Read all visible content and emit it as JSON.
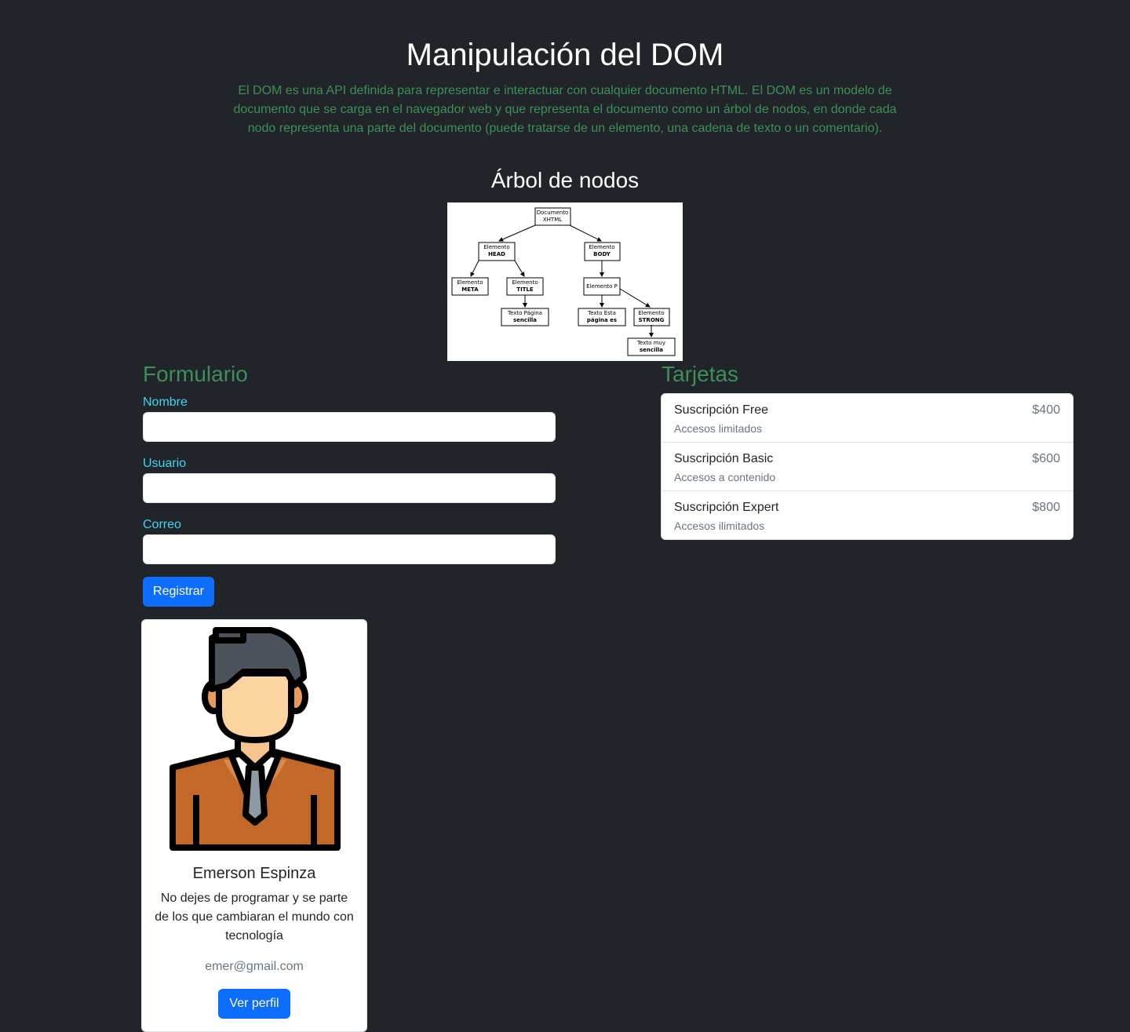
{
  "header": {
    "title": "Manipulación del DOM",
    "intro": "El DOM es una API definida para representar e interactuar con cualquier documento HTML. El DOM es un modelo de documento que se carga en el navegador web y que representa el documento como un árbol de nodos, en donde cada nodo representa una parte del documento (puede tratarse de un elemento, una cadena de texto o un comentario)."
  },
  "tree": {
    "title": "Árbol de nodos",
    "nodes": {
      "doc": [
        "Documento",
        "XHTML"
      ],
      "head": [
        "Elemento",
        "HEAD"
      ],
      "body": [
        "Elemento",
        "BODY"
      ],
      "meta": [
        "Elemento",
        "META"
      ],
      "title": [
        "Elemento",
        "TITLE"
      ],
      "p": [
        "Elemento P"
      ],
      "text_title": [
        "Texto Página",
        "sencilla"
      ],
      "text_p": [
        "Texto Esta",
        "página es"
      ],
      "strong": [
        "Elemento",
        "STRONG"
      ],
      "text_strong": [
        "Texto muy",
        "sencilla"
      ]
    }
  },
  "form": {
    "title": "Formulario",
    "fields": [
      {
        "label": "Nombre",
        "value": "",
        "placeholder": ""
      },
      {
        "label": "Usuario",
        "value": "",
        "placeholder": ""
      },
      {
        "label": "Correo",
        "value": "",
        "placeholder": ""
      }
    ],
    "submit_label": "Registrar"
  },
  "cards": {
    "title": "Tarjetas",
    "items": [
      {
        "name": "Suscripción Free",
        "desc": "Accesos limitados",
        "price": "$400"
      },
      {
        "name": "Suscripción Basic",
        "desc": "Accesos a contenido",
        "price": "$600"
      },
      {
        "name": "Suscripción Expert",
        "desc": "Accesos ilimitados",
        "price": "$800"
      }
    ]
  },
  "profile": {
    "name": "Emerson Espinza",
    "text": "No dejes de programar y se parte de los que cambiaran el mundo con tecnología",
    "email": "emer@gmail.com",
    "button_label": "Ver perfil",
    "avatar_icon": "person-avatar-icon"
  },
  "colors": {
    "background": "#212529",
    "accent_green": "#3e8e5c",
    "label_cyan": "#3dd5f3",
    "primary": "#0d6efd"
  }
}
